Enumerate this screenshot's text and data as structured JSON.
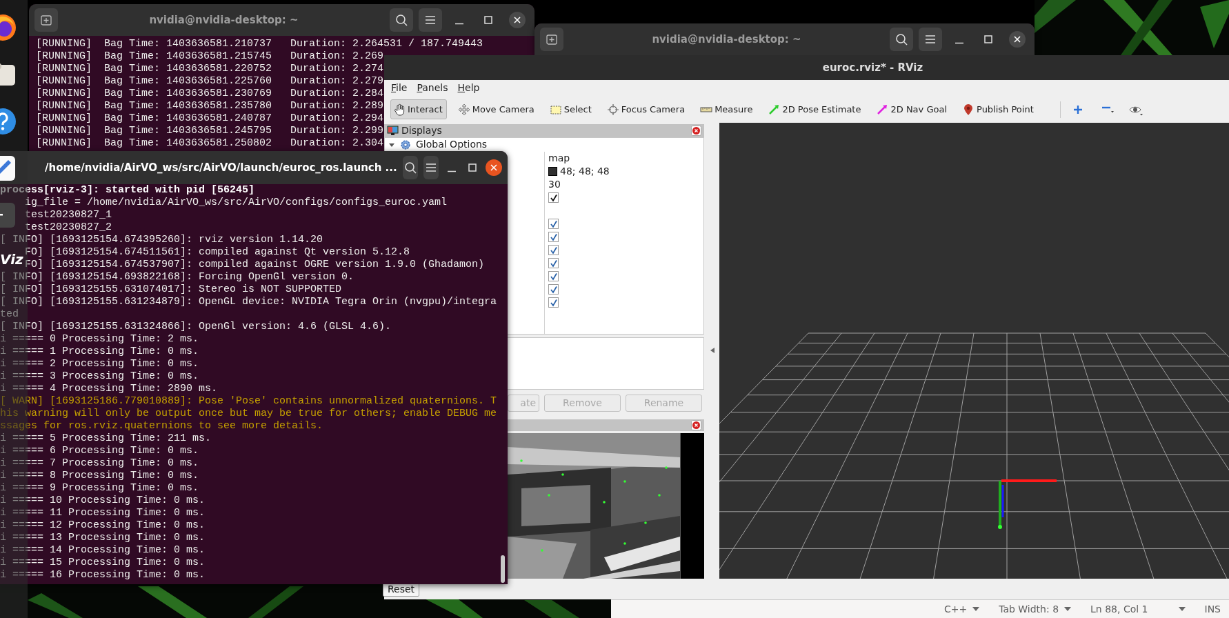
{
  "dock": {
    "items": [
      {
        "kind": "firefox"
      },
      {
        "kind": "files"
      },
      {
        "kind": "help"
      },
      {
        "kind": "editor"
      },
      {
        "kind": "terminal"
      },
      {
        "kind": "rviz",
        "label": "Viz"
      }
    ]
  },
  "terminal_back": {
    "title": "nvidia@nvidia-desktop: ~",
    "lines": [
      "[RUNNING]  Bag Time: 1403636581.210737   Duration: 2.264531 / 187.749443",
      "[RUNNING]  Bag Time: 1403636581.215745   Duration: 2.269",
      "[RUNNING]  Bag Time: 1403636581.220752   Duration: 2.274",
      "[RUNNING]  Bag Time: 1403636581.225760   Duration: 2.279",
      "[RUNNING]  Bag Time: 1403636581.230769   Duration: 2.284",
      "[RUNNING]  Bag Time: 1403636581.235780   Duration: 2.289",
      "[RUNNING]  Bag Time: 1403636581.240787   Duration: 2.294",
      "[RUNNING]  Bag Time: 1403636581.245795   Duration: 2.299",
      "[RUNNING]  Bag Time: 1403636581.250802   Duration: 2.304"
    ]
  },
  "terminal_middle": {
    "title": "nvidia@nvidia-desktop: ~"
  },
  "rviz": {
    "title": "euroc.rviz* - RViz",
    "menu": [
      "File",
      "Panels",
      "Help"
    ],
    "toolbar": [
      {
        "kind": "interact",
        "label": "Interact",
        "selected": true
      },
      {
        "kind": "move",
        "label": "Move Camera",
        "selected": false
      },
      {
        "kind": "select",
        "label": "Select",
        "selected": false
      },
      {
        "kind": "focus",
        "label": "Focus Camera",
        "selected": false
      },
      {
        "kind": "measure",
        "label": "Measure",
        "selected": false
      },
      {
        "kind": "pose",
        "label": "2D Pose Estimate",
        "selected": false
      },
      {
        "kind": "nav",
        "label": "2D Nav Goal",
        "selected": false
      },
      {
        "kind": "publish",
        "label": "Publish Point",
        "selected": false
      },
      {
        "kind": "add"
      },
      {
        "kind": "remove"
      },
      {
        "kind": "view"
      }
    ],
    "displays": {
      "title": "Displays",
      "tree": [
        {
          "label": "Global Options",
          "expanded": true
        }
      ],
      "values": [
        {
          "kind": "text",
          "value": "map"
        },
        {
          "kind": "color",
          "value": "48; 48; 48",
          "color": "#303030"
        },
        {
          "kind": "text",
          "value": "30"
        },
        {
          "kind": "check",
          "checked": true
        },
        {
          "kind": "blank"
        },
        {
          "kind": "display-check",
          "checked": true
        },
        {
          "kind": "display-check",
          "checked": true
        },
        {
          "kind": "display-check",
          "checked": true
        },
        {
          "kind": "display-check",
          "checked": true
        },
        {
          "kind": "display-check",
          "checked": true
        },
        {
          "kind": "display-check",
          "checked": true
        },
        {
          "kind": "display-check",
          "checked": true
        }
      ],
      "buttons": [
        {
          "label": "ate",
          "disabled": true
        },
        {
          "label": "Remove",
          "disabled": true
        },
        {
          "label": "Rename",
          "disabled": true
        }
      ]
    },
    "reset_button": "Reset"
  },
  "terminal_front": {
    "title": "/home/nvidia/AirVO_ws/src/AirVO/launch/euroc_ros.launch ...",
    "lines": [
      {
        "kind": "bold",
        "text": "process[rviz-3]: started with pid [56245]"
      },
      {
        "kind": "plain",
        "text": "    ig_file = /home/nvidia/AirVO_ws/src/AirVO/configs/configs_euroc.yaml"
      },
      {
        "kind": "plain",
        "text": "    test20230827_1"
      },
      {
        "kind": "plain",
        "text": "    test20230827_2"
      },
      {
        "kind": "plain",
        "text": "[ INFO] [1693125154.674395260]: rviz version 1.14.20"
      },
      {
        "kind": "plain",
        "text": "    FO] [1693125154.674511561]: compiled against Qt version 5.12.8"
      },
      {
        "kind": "plain",
        "text": "    FO] [1693125154.674537907]: compiled against OGRE version 1.9.0 (Ghadamon)"
      },
      {
        "kind": "plain",
        "text": "[ INFO] [1693125154.693822168]: Forcing OpenGl version 0."
      },
      {
        "kind": "plain",
        "text": "[ INFO] [1693125155.631074017]: Stereo is NOT SUPPORTED"
      },
      {
        "kind": "plain",
        "text": "[ INFO] [1693125155.631234879]: OpenGL device: NVIDIA Tegra Orin (nvgpu)/integra"
      },
      {
        "kind": "plain",
        "text": "ted"
      },
      {
        "kind": "plain",
        "text": "[ INFO] [1693125155.631324866]: OpenGl version: 4.6 (GLSL 4.6)."
      },
      {
        "kind": "plain",
        "text": "i ===== 0 Processing Time: 2 ms."
      },
      {
        "kind": "plain",
        "text": "i ===== 1 Processing Time: 0 ms."
      },
      {
        "kind": "plain",
        "text": "i ===== 2 Processing Time: 0 ms."
      },
      {
        "kind": "plain",
        "text": "i ===== 3 Processing Time: 0 ms."
      },
      {
        "kind": "plain",
        "text": "i ===== 4 Processing Time: 2890 ms."
      },
      {
        "kind": "warn",
        "text": "[ WARN] [1693125186.779010889]: Pose 'Pose' contains unnormalized quaternions. T"
      },
      {
        "kind": "warn",
        "text": "his warning will only be output once but may be true for others; enable DEBUG me"
      },
      {
        "kind": "warn",
        "text": "ssages for ros.rviz.quaternions to see more details."
      },
      {
        "kind": "plain",
        "text": "i ===== 5 Processing Time: 211 ms."
      },
      {
        "kind": "plain",
        "text": "i ===== 6 Processing Time: 0 ms."
      },
      {
        "kind": "plain",
        "text": "i ===== 7 Processing Time: 0 ms."
      },
      {
        "kind": "plain",
        "text": "i ===== 8 Processing Time: 0 ms."
      },
      {
        "kind": "plain",
        "text": "i ===== 9 Processing Time: 0 ms."
      },
      {
        "kind": "plain",
        "text": "i ===== 10 Processing Time: 0 ms."
      },
      {
        "kind": "plain",
        "text": "i ===== 11 Processing Time: 0 ms."
      },
      {
        "kind": "plain",
        "text": "i ===== 12 Processing Time: 0 ms."
      },
      {
        "kind": "plain",
        "text": "i ===== 13 Processing Time: 0 ms."
      },
      {
        "kind": "plain",
        "text": "i ===== 14 Processing Time: 0 ms."
      },
      {
        "kind": "plain",
        "text": "i ===== 15 Processing Time: 0 ms."
      },
      {
        "kind": "plain",
        "text": "i ===== 16 Processing Time: 0 ms."
      }
    ]
  },
  "editor_status": {
    "items": [
      {
        "text": "C++",
        "dropdown": true
      },
      {
        "text": "Tab Width: 8",
        "dropdown": true
      },
      {
        "text": "Ln 88, Col 1",
        "dropdown": true
      },
      {
        "text": "INS",
        "dropdown": false
      }
    ]
  }
}
